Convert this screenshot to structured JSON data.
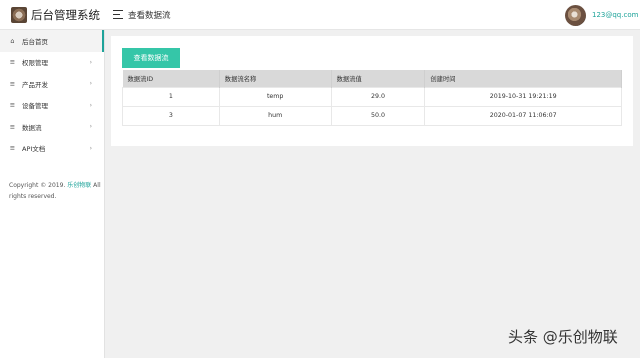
{
  "app": {
    "title": "后台管理系统"
  },
  "header": {
    "page_title": "查看数据流",
    "user_email": "123@qq.com"
  },
  "sidebar": {
    "items": [
      {
        "label": "后台首页",
        "icon": "home-icon"
      },
      {
        "label": "权限管理",
        "icon": "list-icon"
      },
      {
        "label": "产品开发",
        "icon": "list-icon"
      },
      {
        "label": "设备管理",
        "icon": "list-icon"
      },
      {
        "label": "数据流",
        "icon": "list-icon"
      },
      {
        "label": "API文档",
        "icon": "list-icon"
      }
    ],
    "copyright_prefix": "Copyright © 2019.",
    "copyright_brand": "乐创物联",
    "copyright_suffix": "All rights reserved."
  },
  "main": {
    "view_button": "查看数据流",
    "table": {
      "headers": [
        "数据流ID",
        "数据流名称",
        "数据流值",
        "创建时间"
      ],
      "rows": [
        [
          "1",
          "temp",
          "29.0",
          "2019-10-31 19:21:19"
        ],
        [
          "3",
          "hum",
          "50.0",
          "2020-01-07 11:06:07"
        ]
      ]
    }
  },
  "watermark": "头条 @乐创物联",
  "colors": {
    "accent": "#1ea39a",
    "button": "#35c6a8",
    "table_header": "#d9d9d9"
  }
}
